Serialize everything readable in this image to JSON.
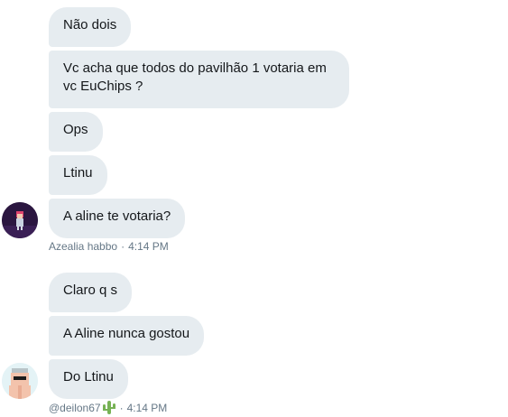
{
  "conversation": {
    "group1": {
      "messages": [
        "Não dois",
        [
          "Vc acha que todos do pavilhão 1 votaria em",
          "vc EuChips ?"
        ],
        "Ops",
        "Ltinu",
        "A aline te votaria?"
      ],
      "sender": "Azealia habbo",
      "separator": "·",
      "time": "4:14 PM",
      "avatar_icon": "habbo-avatar-dark"
    },
    "group2": {
      "messages": [
        "Claro q s",
        "A Aline nunca gostou",
        "Do Ltinu"
      ],
      "sender": "@deilon67",
      "sender_emoji": "cactus-icon",
      "separator": "·",
      "time": "4:14 PM",
      "avatar_icon": "habbo-avatar-light"
    }
  },
  "colors": {
    "bubble_bg": "#e6ecf0",
    "text": "#14171a",
    "meta": "#657786",
    "cactus": "#77b255"
  }
}
